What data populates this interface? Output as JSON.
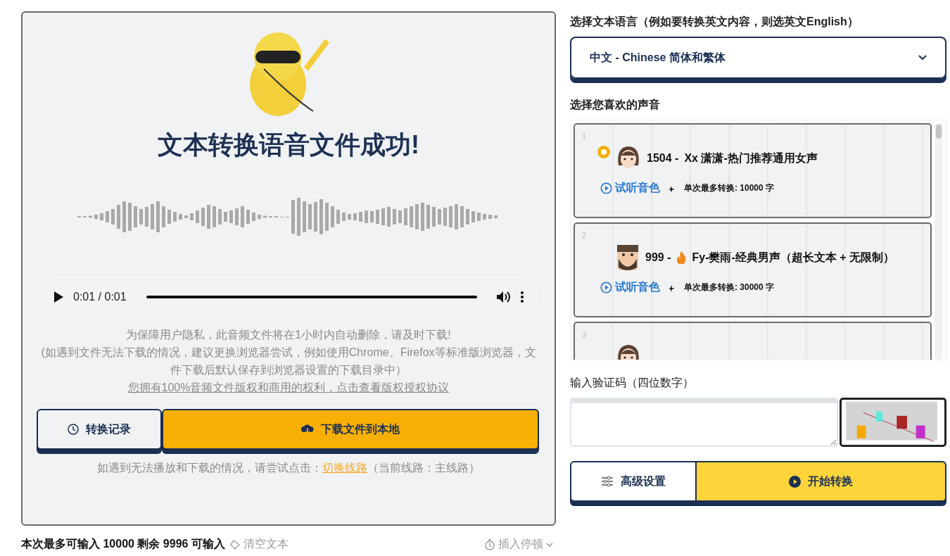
{
  "result": {
    "title": "文本转换语音文件成功!",
    "player": {
      "time": "0:01 / 0:01",
      "level": 1
    },
    "notes": [
      "为保障用户隐私，此音频文件将在1小时内自动删除，请及时下载!",
      "(如遇到文件无法下载的情况，建议更换浏览器尝试，例如使用Chrome、Firefox等标准版浏览器，文件下载后默认保存到浏览器设置的下载目录中）"
    ],
    "license_link": "您拥有100%音频文件版权和商用的权利，点击查看版权授权协议",
    "history_button": "转换记录",
    "download_button": "下载文件到本地",
    "route_hint": "如遇到无法播放和下载的情况，请尝试点击：",
    "route_link": "切换线路",
    "route_current": "（当前线路：主线路）"
  },
  "input_bar": {
    "counter": "本次最多可输入 10000 剩余 9996 可输入",
    "clear": "清空文本",
    "pause": "插入停顿"
  },
  "language": {
    "label": "选择文本语言（例如要转换英文内容，则选英文English）",
    "value": "中文 - Chinese 简体和繁体"
  },
  "voices": {
    "label": "选择您喜欢的声音",
    "items": [
      {
        "index": "1",
        "selected": true,
        "kind": "woman",
        "hot": false,
        "code": "1504 -",
        "name": "Xx 潇潇-热门推荐通用女声",
        "listen": "试听音色",
        "limit": "单次最多转换: 10000 字"
      },
      {
        "index": "2",
        "selected": false,
        "kind": "man",
        "hot": true,
        "code": "999 -",
        "name": "Fy-樊雨-经典男声（超长文本 + 无限制）",
        "listen": "试听音色",
        "limit": "单次最多转换: 30000 字"
      },
      {
        "index": "3",
        "selected": false,
        "kind": "woman"
      }
    ]
  },
  "captcha": {
    "label": "输入验证码（四位数字）"
  },
  "actions": {
    "settings": "高级设置",
    "start": "开始转换"
  }
}
